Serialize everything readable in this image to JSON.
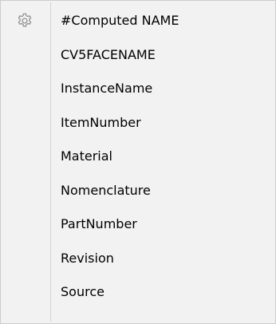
{
  "menu": {
    "icon": "gear-icon",
    "items": [
      {
        "label": "#Computed NAME"
      },
      {
        "label": "CV5FACENAME"
      },
      {
        "label": "InstanceName"
      },
      {
        "label": "ItemNumber"
      },
      {
        "label": "Material"
      },
      {
        "label": "Nomenclature"
      },
      {
        "label": "PartNumber"
      },
      {
        "label": "Revision"
      },
      {
        "label": "Source"
      }
    ]
  }
}
